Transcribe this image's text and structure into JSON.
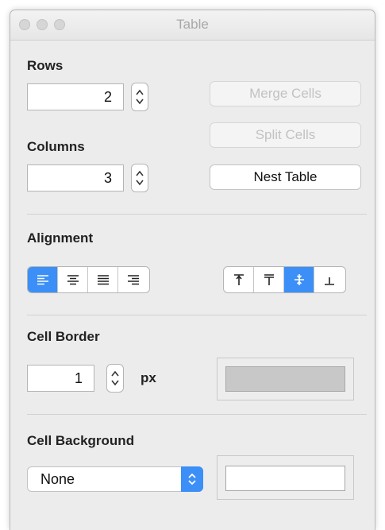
{
  "window": {
    "title": "Table"
  },
  "rows": {
    "label": "Rows",
    "value": "2"
  },
  "columns": {
    "label": "Columns",
    "value": "3"
  },
  "buttons": {
    "merge": "Merge Cells",
    "split": "Split Cells",
    "nest": "Nest Table"
  },
  "alignment": {
    "label": "Alignment",
    "horizontal": [
      "align-left-icon",
      "align-center-icon",
      "align-justify-icon",
      "align-right-icon"
    ],
    "horizontal_selected": "align-left-icon",
    "vertical": [
      "align-top-icon",
      "align-baseline-icon",
      "align-middle-icon",
      "align-bottom-icon"
    ],
    "vertical_selected": "align-middle-icon"
  },
  "cell_border": {
    "label": "Cell Border",
    "value": "1",
    "unit": "px",
    "color": "#c8c8c8"
  },
  "cell_background": {
    "label": "Cell Background",
    "selected": "None",
    "color": "#ffffff"
  },
  "colors": {
    "accent": "#3b8ff6",
    "panel": "#ececec"
  }
}
